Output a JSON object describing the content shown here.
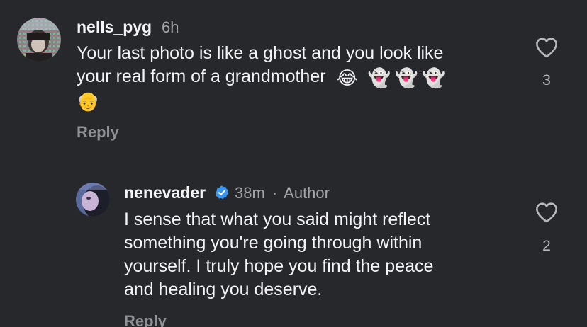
{
  "comment": {
    "username": "nells_pyg",
    "time": "6h",
    "text_lines": [
      "Your last photo is like a ghost and you look like",
      "your real form of a grandmother"
    ],
    "emojis_line2": [
      "😂",
      "👻",
      "👻",
      "👻"
    ],
    "emojis_line3": [
      "👴"
    ],
    "reply_label": "Reply",
    "like_count": "3",
    "icons": {
      "like": "heart-outline-icon"
    }
  },
  "reply": {
    "username": "nenevader",
    "verified": true,
    "time": "38m",
    "separator": "·",
    "author_label": "Author",
    "text_lines": [
      "I sense that what you said might reflect",
      "something you're going through within",
      "yourself. I truly hope you find the peace",
      "and healing you deserve."
    ],
    "reply_label": "Reply",
    "like_count": "2",
    "icons": {
      "like": "heart-outline-icon",
      "verified": "verified-badge-icon"
    }
  },
  "colors": {
    "background": "#27282c",
    "text": "#f4f4f6",
    "muted": "#a4a5aa",
    "verified_blue": "#3797f0"
  }
}
